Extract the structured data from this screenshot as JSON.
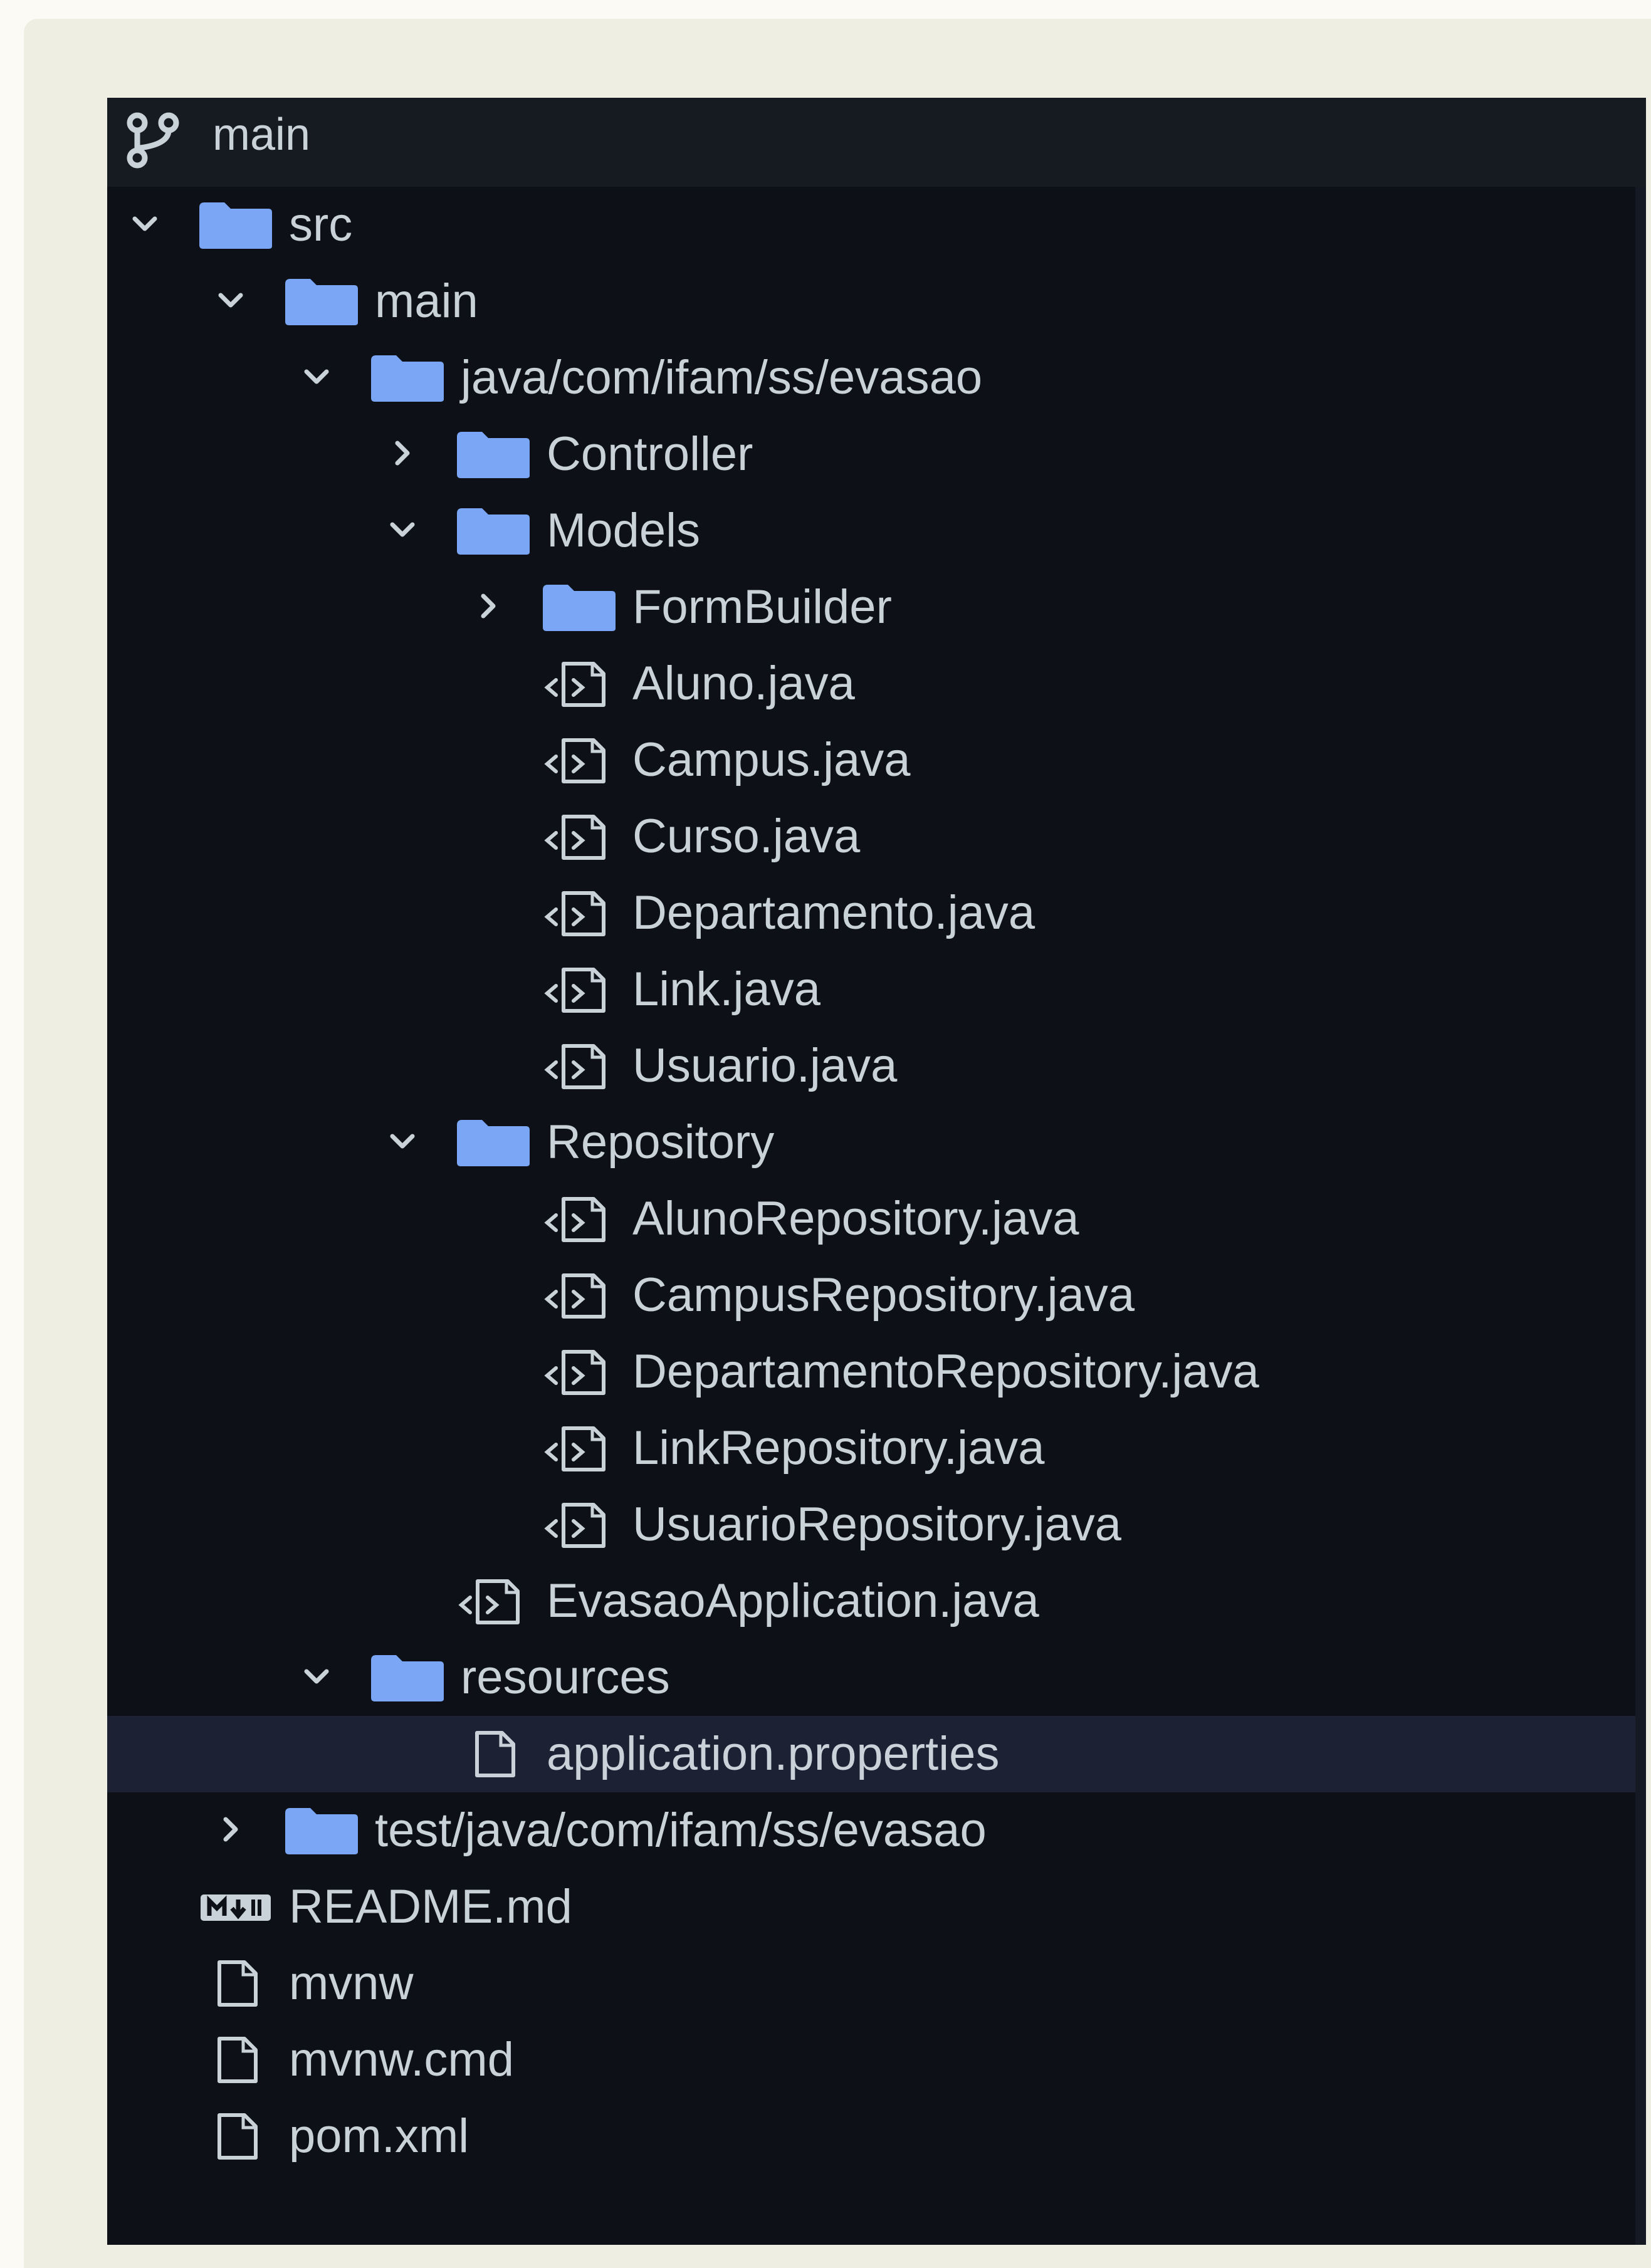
{
  "branch": {
    "icon": "git-branch-icon",
    "name": "main"
  },
  "tree": [
    {
      "name": "src",
      "type": "folder",
      "depth": 0,
      "expanded": true
    },
    {
      "name": "main",
      "type": "folder",
      "depth": 1,
      "expanded": true
    },
    {
      "name": "java/com/ifam/ss/evasao",
      "type": "folder",
      "depth": 2,
      "expanded": true
    },
    {
      "name": "Controller",
      "type": "folder",
      "depth": 3,
      "expanded": false
    },
    {
      "name": "Models",
      "type": "folder",
      "depth": 3,
      "expanded": true
    },
    {
      "name": "FormBuilder",
      "type": "folder",
      "depth": 4,
      "expanded": false
    },
    {
      "name": "Aluno.java",
      "type": "code",
      "depth": 4
    },
    {
      "name": "Campus.java",
      "type": "code",
      "depth": 4
    },
    {
      "name": "Curso.java",
      "type": "code",
      "depth": 4
    },
    {
      "name": "Departamento.java",
      "type": "code",
      "depth": 4
    },
    {
      "name": "Link.java",
      "type": "code",
      "depth": 4
    },
    {
      "name": "Usuario.java",
      "type": "code",
      "depth": 4
    },
    {
      "name": "Repository",
      "type": "folder",
      "depth": 3,
      "expanded": true
    },
    {
      "name": "AlunoRepository.java",
      "type": "code",
      "depth": 4
    },
    {
      "name": "CampusRepository.java",
      "type": "code",
      "depth": 4
    },
    {
      "name": "DepartamentoRepository.java",
      "type": "code",
      "depth": 4,
      "truncated": true
    },
    {
      "name": "LinkRepository.java",
      "type": "code",
      "depth": 4
    },
    {
      "name": "UsuarioRepository.java",
      "type": "code",
      "depth": 4
    },
    {
      "name": "EvasaoApplication.java",
      "type": "code",
      "depth": 3
    },
    {
      "name": "resources",
      "type": "folder",
      "depth": 2,
      "expanded": true
    },
    {
      "name": "application.properties",
      "type": "file",
      "depth": 3,
      "selected": true
    },
    {
      "name": "test/java/com/ifam/ss/evasao",
      "type": "folder",
      "depth": 1,
      "expanded": false
    },
    {
      "name": "README.md",
      "type": "markdown",
      "depth": 0
    },
    {
      "name": "mvnw",
      "type": "file",
      "depth": 0
    },
    {
      "name": "mvnw.cmd",
      "type": "file",
      "depth": 0
    },
    {
      "name": "pom.xml",
      "type": "file",
      "depth": 0
    }
  ],
  "colors": {
    "background": "#0d1117",
    "header": "#161b22",
    "text": "#c9d1d9",
    "folder": "#7aa6f5",
    "selected_row": "#1c2233",
    "frame": "#efeee2"
  }
}
